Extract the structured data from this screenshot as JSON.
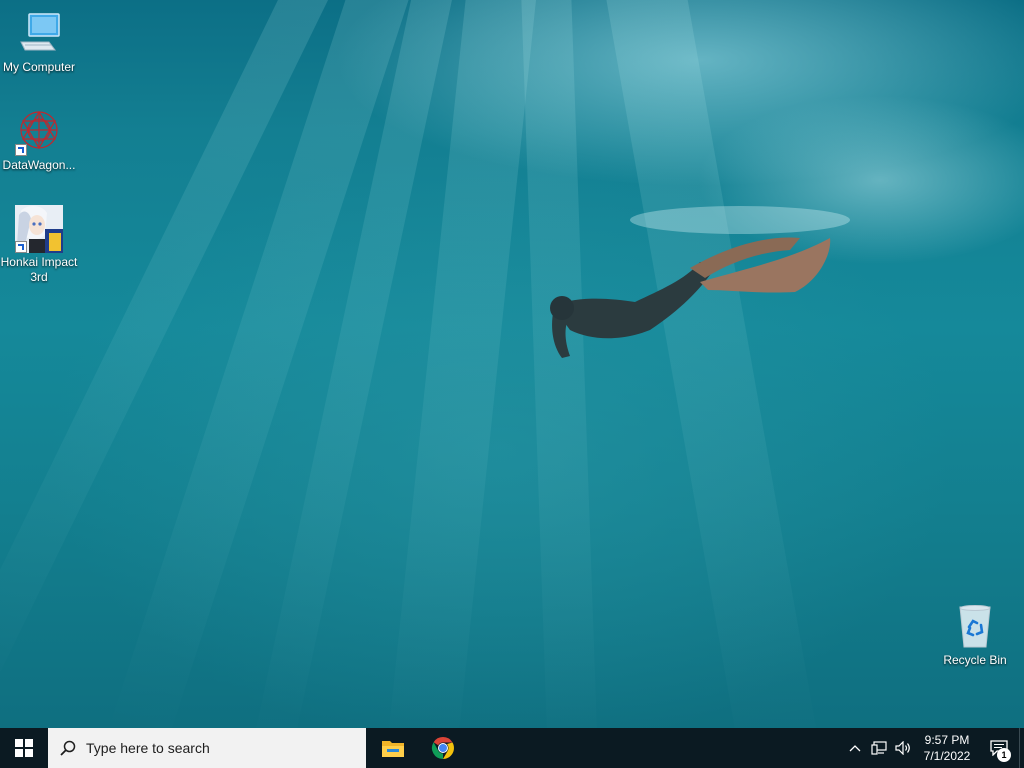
{
  "desktop": {
    "icons": [
      {
        "label": "My Computer",
        "icon": "my-computer-icon"
      },
      {
        "label": "DataWagon...",
        "icon": "datawagon-icon"
      },
      {
        "label": "Honkai Impact 3rd",
        "icon": "honkai-impact-icon"
      },
      {
        "label": "Recycle Bin",
        "icon": "recycle-bin-icon"
      }
    ]
  },
  "taskbar": {
    "start_icon": "windows-start-icon",
    "search": {
      "placeholder": "Type here to search",
      "icon": "search-icon"
    },
    "apps": [
      {
        "name": "File Explorer",
        "icon": "file-explorer-icon"
      },
      {
        "name": "Google Chrome",
        "icon": "chrome-icon"
      }
    ],
    "tray": {
      "icons": [
        "chevron-up-icon",
        "network-icon",
        "volume-icon"
      ],
      "time": "9:57 PM",
      "date": "7/1/2022",
      "notifications_icon": "notification-icon",
      "notification_count": "1"
    }
  },
  "colors": {
    "taskbar_bg": "#0b1a22",
    "search_bg": "#f2f2f2",
    "water": "#137f92"
  }
}
